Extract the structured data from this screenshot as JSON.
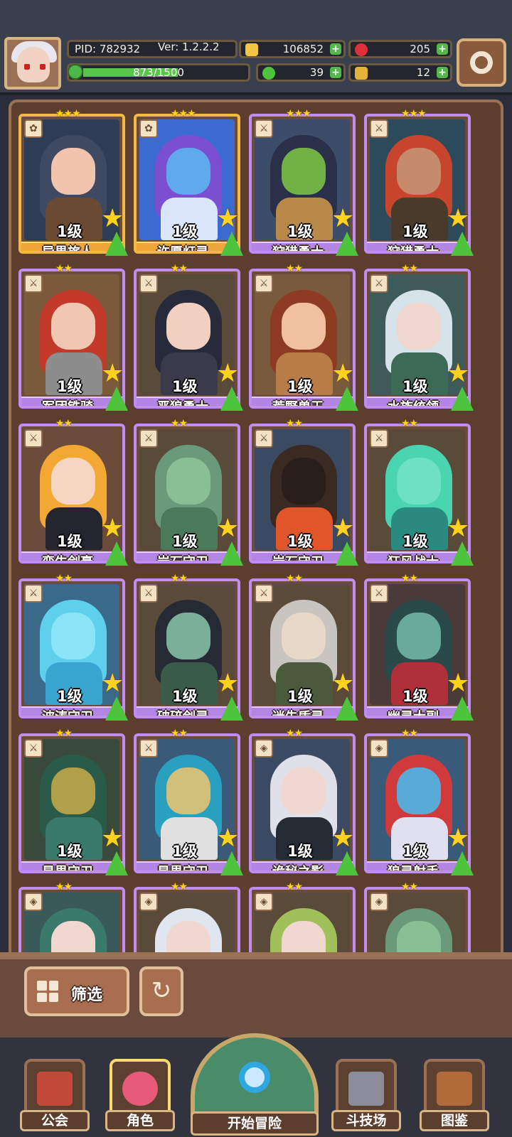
{
  "header": {
    "pid": "PID: 782932",
    "version": "Ver: 1.2.2.2",
    "xp": "873/1500",
    "xp_fraction": 0.582,
    "gold": "106852",
    "gems": "205",
    "clover": "39",
    "keys": "12"
  },
  "colors": {
    "rare_frame": "#f3b845",
    "epic_frame": "#c08df0",
    "plus_button": "#53b84a",
    "star": "#ffd21d"
  },
  "cards": [
    {
      "name": "异界旅人",
      "level": "1级",
      "tier": "gold",
      "stars": "★★★",
      "type_icon": "✿",
      "palette": [
        "#2f3c55",
        "#3d4a62",
        "#f1c4ae",
        "#6b4a34"
      ]
    },
    {
      "name": "许愿灯灵",
      "level": "1级",
      "tier": "gold",
      "stars": "★★★",
      "type_icon": "✿",
      "palette": [
        "#3b6ad0",
        "#7b4fd0",
        "#5fa9ec",
        "#d9e5f8"
      ]
    },
    {
      "name": "狩猎勇士",
      "level": "1级",
      "tier": "epic",
      "stars": "★★★",
      "type_icon": "⚔",
      "palette": [
        "#3c4d6c",
        "#2a2f4a",
        "#71b145",
        "#b88a4a"
      ]
    },
    {
      "name": "狩猎勇士",
      "level": "1级",
      "tier": "epic",
      "stars": "★★★",
      "type_icon": "⚔",
      "palette": [
        "#2c4a5a",
        "#c8452d",
        "#c58b6a",
        "#4a3a2a"
      ]
    },
    {
      "name": "军团铁骑",
      "level": "1级",
      "tier": "epic",
      "stars": "★★",
      "type_icon": "⚔",
      "palette": [
        "#7c5a3c",
        "#c43a2a",
        "#f0c8b2",
        "#8d8d8d"
      ]
    },
    {
      "name": "恶狼勇士",
      "level": "1级",
      "tier": "epic",
      "stars": "★★",
      "type_icon": "⚔",
      "palette": [
        "#5a4a3a",
        "#262a3a",
        "#f1d0c0",
        "#3a3a4a"
      ]
    },
    {
      "name": "荒野兽王",
      "level": "1级",
      "tier": "epic",
      "stars": "★★",
      "type_icon": "⚔",
      "palette": [
        "#7a5a3c",
        "#8d3b22",
        "#f0c0a0",
        "#b77c47"
      ]
    },
    {
      "name": "水族统领",
      "level": "1级",
      "tier": "epic",
      "stars": "★★",
      "type_icon": "⚔",
      "palette": [
        "#3e5b5a",
        "#d7e3ea",
        "#f0d8d0",
        "#3c6a56"
      ]
    },
    {
      "name": "蛮牛剑豪",
      "level": "1级",
      "tier": "epic",
      "stars": "★★",
      "type_icon": "⚔",
      "palette": [
        "#6b4c3a",
        "#f2a832",
        "#f6d6c2",
        "#252530"
      ]
    },
    {
      "name": "岩石守卫",
      "level": "1级",
      "tier": "epic",
      "stars": "★★",
      "type_icon": "⚔",
      "palette": [
        "#5a4a3a",
        "#6a9a7a",
        "#8abf95",
        "#4a7a5a"
      ]
    },
    {
      "name": "岩石守卫",
      "level": "1级",
      "tier": "epic",
      "stars": "★★",
      "type_icon": "⚔",
      "palette": [
        "#3a4a62",
        "#3a2a22",
        "#2a1e1a",
        "#e0552a"
      ]
    },
    {
      "name": "狂风战士",
      "level": "1级",
      "tier": "epic",
      "stars": "★★",
      "type_icon": "⚔",
      "palette": [
        "#5a4a3a",
        "#4ad4b2",
        "#6ee0c4",
        "#2a8a80"
      ]
    },
    {
      "name": "波涛守卫",
      "level": "1级",
      "tier": "epic",
      "stars": "★★",
      "type_icon": "⚔",
      "palette": [
        "#3a6a8a",
        "#5fd0ec",
        "#8ae6f6",
        "#3aa4d0"
      ]
    },
    {
      "name": "破碎剑灵",
      "level": "1级",
      "tier": "epic",
      "stars": "★★",
      "type_icon": "⚔",
      "palette": [
        "#5a4a3a",
        "#262a34",
        "#7ab09a",
        "#3a5a4a"
      ]
    },
    {
      "name": "迷失盾灵",
      "level": "1级",
      "tier": "epic",
      "stars": "★★",
      "type_icon": "⚔",
      "palette": [
        "#5a4a3a",
        "#c8c4c0",
        "#e8d8c8",
        "#4a5a3a"
      ]
    },
    {
      "name": "幽灵大副",
      "level": "1级",
      "tier": "epic",
      "stars": "★★",
      "type_icon": "⚔",
      "palette": [
        "#4a3a3a",
        "#2a4a4a",
        "#6aaa9a",
        "#b0303a"
      ]
    },
    {
      "name": "星界守卫",
      "level": "1级",
      "tier": "epic",
      "stars": "★★",
      "type_icon": "⚔",
      "palette": [
        "#3a4a3a",
        "#2a5a4a",
        "#b0a04a",
        "#3a7a6a"
      ]
    },
    {
      "name": "星界守卫",
      "level": "1级",
      "tier": "epic",
      "stars": "★★",
      "type_icon": "⚔",
      "palette": [
        "#3a5a7a",
        "#2aa0c0",
        "#d0c07a",
        "#e0e0e0"
      ]
    },
    {
      "name": "诡秘之影",
      "level": "1级",
      "tier": "epic",
      "stars": "★★",
      "type_icon": "◈",
      "palette": [
        "#3a4a62",
        "#e0e0ea",
        "#f0d8d0",
        "#262a34"
      ]
    },
    {
      "name": "狼灵射手",
      "level": "1级",
      "tier": "epic",
      "stars": "★★",
      "type_icon": "◈",
      "palette": [
        "#3a5a7a",
        "#d03a3a",
        "#5aaad8",
        "#e0e0f0"
      ]
    },
    {
      "name": "",
      "level": "",
      "tier": "epic",
      "stars": "★★",
      "type_icon": "◈",
      "palette": [
        "#3a5a5a",
        "#3a7a6a",
        "#f0d8d0",
        "#2a4a4a"
      ]
    },
    {
      "name": "",
      "level": "",
      "tier": "epic",
      "stars": "★★",
      "type_icon": "◈",
      "palette": [
        "#5a4a3a",
        "#e0e6f0",
        "#f0d8d0",
        "#b0b8c8"
      ]
    },
    {
      "name": "",
      "level": "",
      "tier": "epic",
      "stars": "★★",
      "type_icon": "◈",
      "palette": [
        "#5a4a3a",
        "#a0c05a",
        "#f0d8d0",
        "#7a9a3a"
      ]
    },
    {
      "name": "",
      "level": "",
      "tier": "epic",
      "stars": "★★",
      "type_icon": "◈",
      "palette": [
        "#5a4a3a",
        "#6a9a7a",
        "#8abf95",
        "#4a7a5a"
      ]
    }
  ],
  "controls": {
    "filter_label": "筛选",
    "reset_icon": "refresh-icon"
  },
  "nav": {
    "guild": "公会",
    "character": "角色",
    "adventure": "开始冒险",
    "arena": "斗技场",
    "codex": "图鉴"
  }
}
